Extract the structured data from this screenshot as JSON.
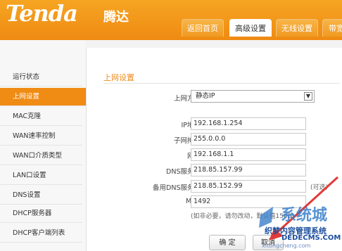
{
  "brand": {
    "logo": "Tenda",
    "logo_cn": "腾达"
  },
  "tabs": [
    {
      "label": "返回首页"
    },
    {
      "label": "高级设置"
    },
    {
      "label": "无线设置"
    },
    {
      "label": "带宽"
    }
  ],
  "sidebar": {
    "items": [
      {
        "label": "运行状态"
      },
      {
        "label": "上网设置"
      },
      {
        "label": "MAC克隆"
      },
      {
        "label": "WAN速率控制"
      },
      {
        "label": "WAN口介质类型"
      },
      {
        "label": "LAN口设置"
      },
      {
        "label": "DNS设置"
      },
      {
        "label": "DHCP服务器"
      },
      {
        "label": "DHCP客户端列表"
      }
    ]
  },
  "form": {
    "title": "上网设置",
    "mode_label": "上网方式",
    "mode_value": "静态IP",
    "ip_label": "IP地址",
    "ip_value": "192.168.1.254",
    "mask_label": "子网掩码",
    "mask_value": "255.0.0.0",
    "gateway_label": "网关",
    "gateway_value": "192.168.1.1",
    "dns_label": "DNS服务器",
    "dns_value": "218.85.157.99",
    "dns2_label": "备用DNS服务器",
    "dns2_value": "218.85.152.99",
    "dns2_hint": "(可选)",
    "mtu_label": "MTU",
    "mtu_value": "1492",
    "mtu_hint": "(如非必要，请勿改动，默认值1500)",
    "confirm_label": "确 定",
    "cancel_label": "取消"
  },
  "watermark": {
    "big": "系统城",
    "line1": "织梦内容管理系统",
    "line2": "DEDECMS.COM",
    "line3": "xitongcheng.com"
  }
}
